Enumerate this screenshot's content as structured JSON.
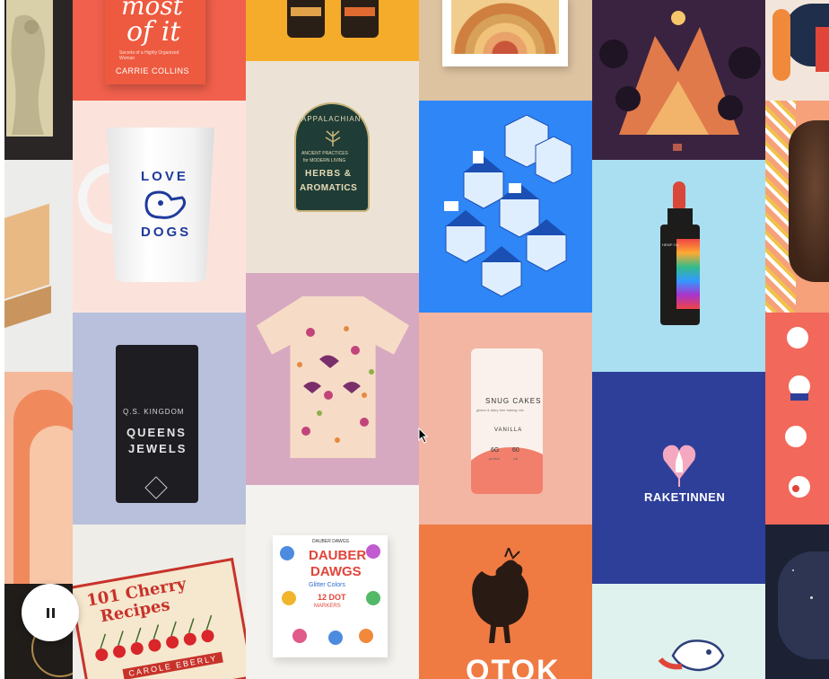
{
  "gallery": {
    "tiles": {
      "book": {
        "title_line1": "most",
        "title_line2": "of it",
        "subtitle": "Secrets of a Highly Organized Woman",
        "author": "CARRIE COLLINS"
      },
      "mug": {
        "line1": "LOVE",
        "line2": "DOGS"
      },
      "badge": {
        "arc": "APPALACHIAN",
        "sub1": "ANCIENT PRACTICES",
        "sub2": "for MODERN LIVING",
        "main1": "HERBS &",
        "main2": "AROMATICS"
      },
      "coffee": {
        "brand": "Q.S. KINGDOM",
        "line1": "QUEENS",
        "line2": "JEWELS"
      },
      "pouch": {
        "brand": "SNUG CAKES",
        "tagline": "gluten & dairy free baking mix",
        "flavor": "VANILLA",
        "stat1": "6G",
        "stat2": "60",
        "stat1_label": "protein",
        "stat2_label": "cal"
      },
      "raketinnen": {
        "name": "RAKETINNEN"
      },
      "cherry": {
        "title1": "101 Cherry",
        "title2": "Recipes",
        "author": "CAROLE EBERLY"
      },
      "crayons": {
        "brand": "DAUBER DAWGS",
        "line1": "DAUBER",
        "line2": "DAWGS",
        "sub": "Glitter Colors",
        "count": "12 DOT",
        "count2": "MARKERS"
      },
      "otok": {
        "name": "OTOK"
      },
      "bottle": {
        "label": "HEMP OIL"
      }
    },
    "pause_button": {
      "label": "Pause",
      "icon": "pause-icon"
    }
  }
}
